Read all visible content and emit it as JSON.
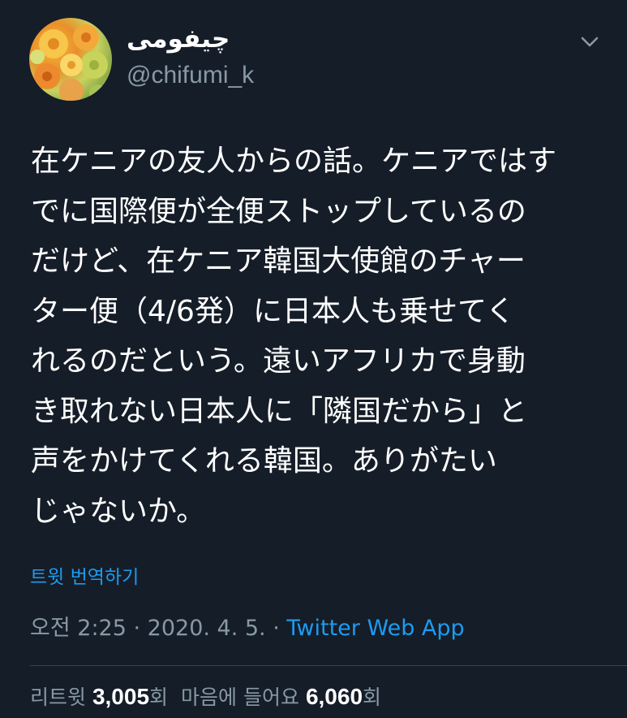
{
  "author": {
    "display_name": "چیفومی",
    "handle": "@chifumi_k",
    "avatar_icon": "flower-bouquet-avatar"
  },
  "menu": {
    "icon": "chevron-down-icon"
  },
  "tweet": {
    "lines": [
      "在ケニアの友人からの話。ケニアではす",
      "でに国際便が全便ストップしているの",
      "だけど、在ケニア韓国大使館のチャー",
      "ター便（4/6発）に日本人も乗せてく",
      "れるのだという。遠いアフリカで身動",
      "き取れない日本人に「隣国だから」と",
      "声をかけてくれる韓国。ありがたい",
      "じゃないか。"
    ]
  },
  "translate_label": "트윗 번역하기",
  "meta": {
    "time": "오전 2:25",
    "separator": " · ",
    "date": "2020. 4. 5.",
    "source": "Twitter Web App"
  },
  "stats": {
    "retweets_label": "리트윗 ",
    "retweets_count": "3,005",
    "retweets_suffix": "회",
    "likes_label": "마음에 들어요 ",
    "likes_count": "6,060",
    "likes_suffix": "회"
  },
  "colors": {
    "background": "#151d28",
    "text": "#ffffff",
    "secondary": "#8899a6",
    "link": "#1d9bf0",
    "divider": "#38444d"
  }
}
